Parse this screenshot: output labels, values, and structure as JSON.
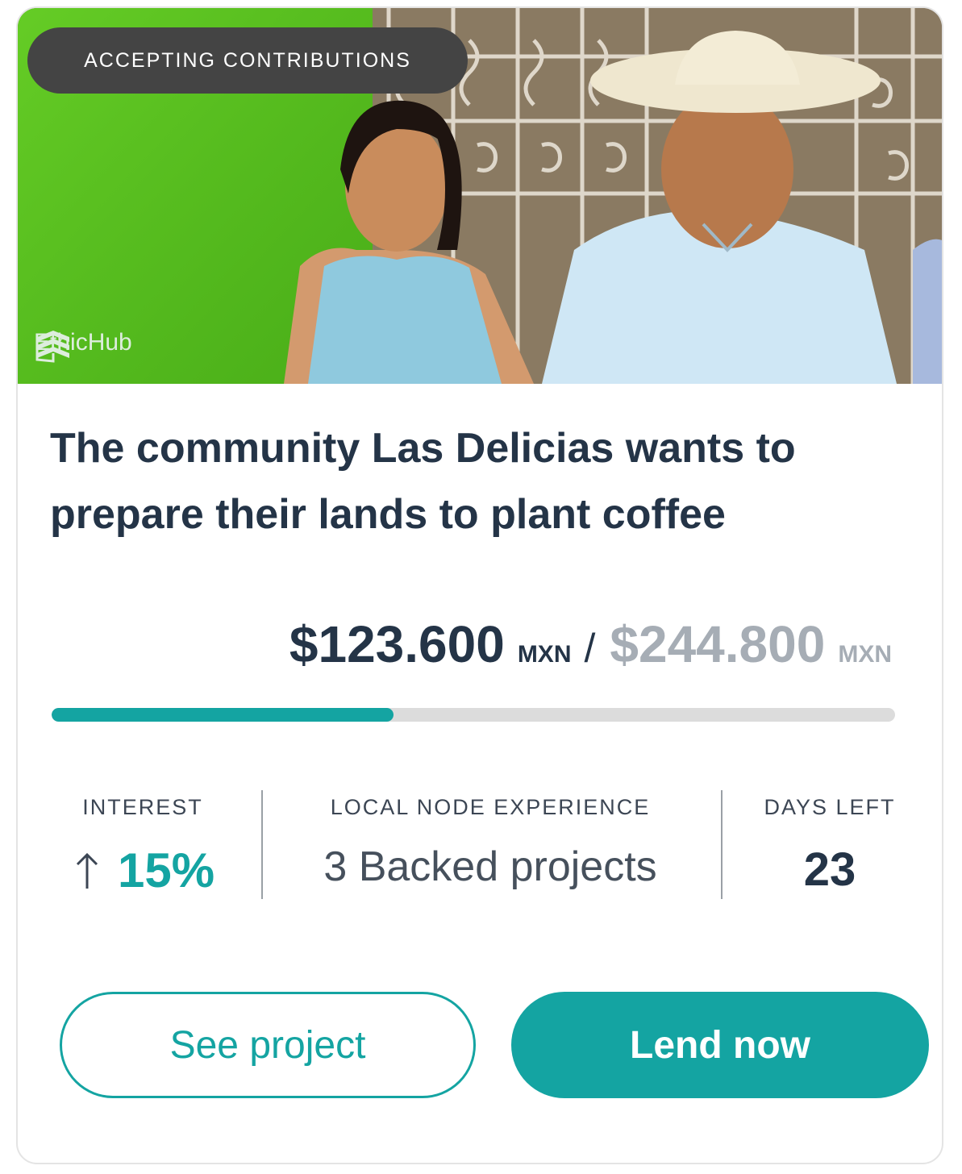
{
  "hero": {
    "status_badge": "ACCEPTING CONTRIBUTIONS",
    "watermark": "EthicHub",
    "photo_icon": "photo-of-two-farmers"
  },
  "project": {
    "title": "The community Las Delicias wants to prepare their lands to plant coffee"
  },
  "funding": {
    "raised": "$123.600",
    "raised_unit": "MXN",
    "separator": "/",
    "goal": "$244.800",
    "goal_unit": "MXN",
    "progress_fraction": 0.405
  },
  "stats": {
    "interest_label": "INTEREST",
    "interest_value": "15%",
    "interest_icon": "arrow-up-icon",
    "experience_label": "LOCAL NODE EXPERIENCE",
    "experience_value": "3 Backed projects",
    "days_label": "DAYS LEFT",
    "days_value": "23"
  },
  "actions": {
    "see_project": "See project",
    "lend_now": "Lend now"
  },
  "colors": {
    "accent": "#14a4a2",
    "heading": "#243447",
    "muted": "#a6adb5",
    "badge_bg": "#444444"
  }
}
